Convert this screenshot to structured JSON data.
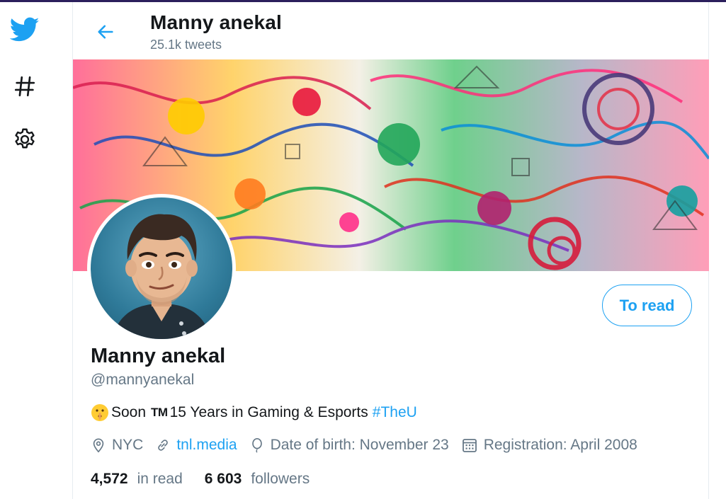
{
  "theme": {
    "accent": "#1da1f2",
    "muted": "#657786",
    "text": "#14171a"
  },
  "nav": [
    {
      "icon": "twitter-bird-icon"
    },
    {
      "icon": "hashtag-icon"
    },
    {
      "icon": "gear-icon"
    }
  ],
  "header": {
    "title": "Manny anekal",
    "subtitle": "25.1k tweets"
  },
  "profile": {
    "name": "Manny anekal",
    "handle": "@mannyanekal",
    "follow_label": "To read",
    "bio": {
      "lead_text": "Soon",
      "tm": "TM",
      "text": "15 Years in Gaming & Esports",
      "hashtag": "#TheU"
    },
    "meta": {
      "location": "NYC",
      "website": "tnl.media",
      "birthday": "Date of birth: November 23",
      "joined": "Registration: April 2008"
    },
    "stats": {
      "following_count": "4,572",
      "following_label": "in read",
      "followers_count": "6 603",
      "followers_label": "followers"
    }
  }
}
